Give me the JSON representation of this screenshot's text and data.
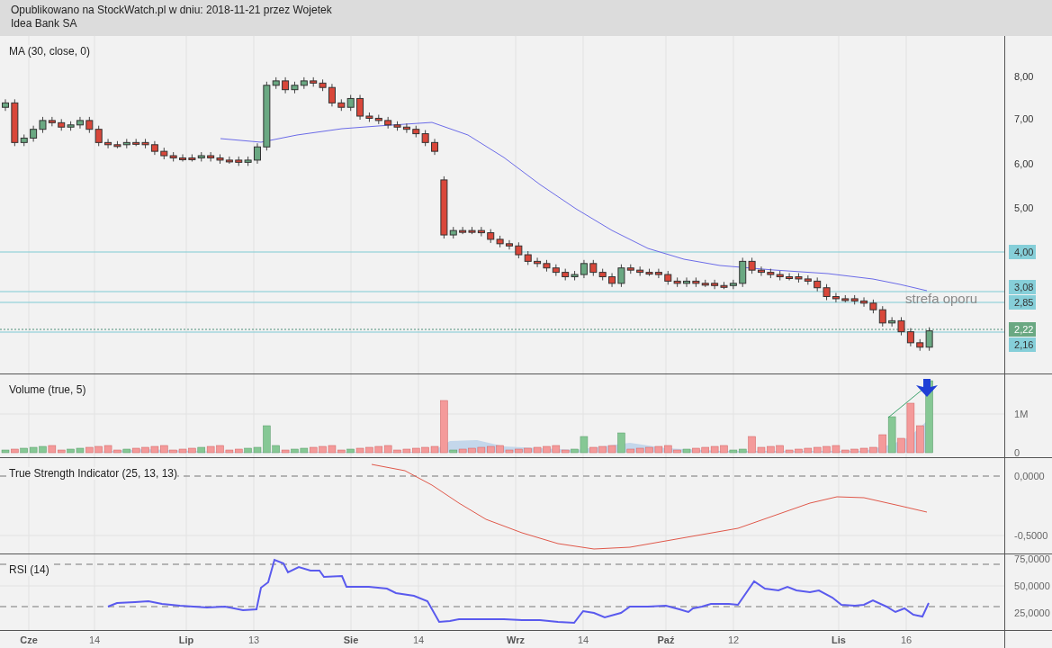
{
  "header": {
    "published": "Opublikowano na StockWatch.pl w dniu: 2018-11-21 przez Wojetek",
    "instrument": "Idea Bank SA"
  },
  "price_panel": {
    "label": "MA (30, close, 0)",
    "annotation": "strefa oporu",
    "axis_labels": [
      {
        "text": "8,00",
        "kind": "tick"
      },
      {
        "text": "7,00",
        "kind": "tick"
      },
      {
        "text": "6,00",
        "kind": "tick"
      },
      {
        "text": "5,00",
        "kind": "tick"
      },
      {
        "text": "4,00",
        "kind": "level"
      },
      {
        "text": "3,08",
        "kind": "level"
      },
      {
        "text": "2,85",
        "kind": "level"
      },
      {
        "text": "2,22",
        "kind": "current"
      },
      {
        "text": "2,16",
        "kind": "level"
      }
    ]
  },
  "volume_panel": {
    "label": "Volume (true, 5)",
    "axis_labels": [
      "1M",
      "0"
    ]
  },
  "tsi_panel": {
    "label": "True Strength Indicator (25, 13, 13)",
    "axis_labels": [
      "0,0000",
      "-0,5000"
    ]
  },
  "rsi_panel": {
    "label": "RSI (14)",
    "axis_labels": [
      "75,0000",
      "50,0000",
      "25,0000"
    ]
  },
  "x_axis": [
    {
      "text": "Cze",
      "kind": "month"
    },
    {
      "text": "14",
      "kind": "day"
    },
    {
      "text": "Lip",
      "kind": "month"
    },
    {
      "text": "13",
      "kind": "day"
    },
    {
      "text": "Sie",
      "kind": "month"
    },
    {
      "text": "14",
      "kind": "day"
    },
    {
      "text": "Wrz",
      "kind": "month"
    },
    {
      "text": "14",
      "kind": "day"
    },
    {
      "text": "Paź",
      "kind": "month"
    },
    {
      "text": "12",
      "kind": "day"
    },
    {
      "text": "Lis",
      "kind": "month"
    },
    {
      "text": "16",
      "kind": "day"
    }
  ]
}
